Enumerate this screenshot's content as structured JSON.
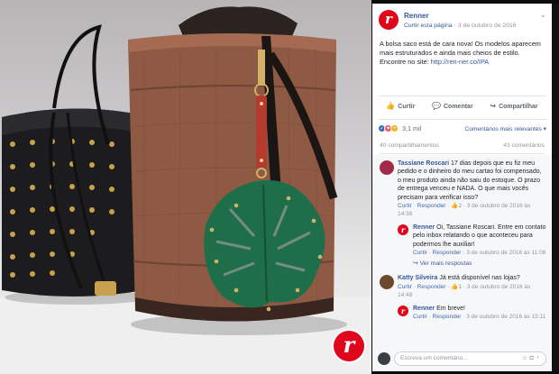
{
  "photo": {
    "logo_letter": "r"
  },
  "post": {
    "page_name": "Renner",
    "like_page": "Curtir esta página",
    "date": "3 de outubro de 2016",
    "text": "A bolsa saco está de cara nova! Os modelos aparecem mais estruturados e ainda mais cheios de estilo. Encontre no site: ",
    "link": "http://ren-ner.co/IPA",
    "actions": {
      "like": "Curtir",
      "comment": "Comentar",
      "share": "Compartilhar"
    },
    "reactions_count": "3,1 mil",
    "sort_label": "Comentários mais relevantes",
    "shares": "40 compartilhamentos",
    "comments_count": "43 comentários"
  },
  "comments": [
    {
      "author": "Tassiane Roscari",
      "text": "17 dias depois que eu fiz meu pedido e o dinheiro do meu cartao foi compensado, o meu produto ainda não saiu do estoque. O prazo de entrega venceu e NADA. O que mais vocês precisam para verificar isso?",
      "like": "Curtir",
      "respond": "Responder",
      "likes": "2",
      "date": "3 de outubro de 2016 às 14:38",
      "reply": {
        "author": "Renner",
        "text": "Oi, Tassiane Roscari. Entre em contato pelo inbox relatando o que aconteceu para podermos lhe auxiliar!",
        "like": "Curtir",
        "respond": "Responder",
        "date": "3 de outubro de 2016 às 11:08"
      },
      "more_replies": "Ver mais respostas"
    },
    {
      "author": "Katty Silveira",
      "text": "Já está disponível nas lojas?",
      "like": "Curtir",
      "respond": "Responder",
      "likes": "1",
      "date": "3 de outubro de 2016 às 14:48",
      "reply": {
        "author": "Renner",
        "text": "Em breve!",
        "like": "Curtir",
        "respond": "Responder",
        "date": "3 de outubro de 2016 às 15:11"
      }
    }
  ],
  "compose": {
    "placeholder": "Escreva um comentário..."
  },
  "colors": {
    "brand_red": "#e0061b",
    "fb_blue": "#365899",
    "bag_brown": "#8c5a45",
    "leaf_green": "#1f6e4a"
  }
}
